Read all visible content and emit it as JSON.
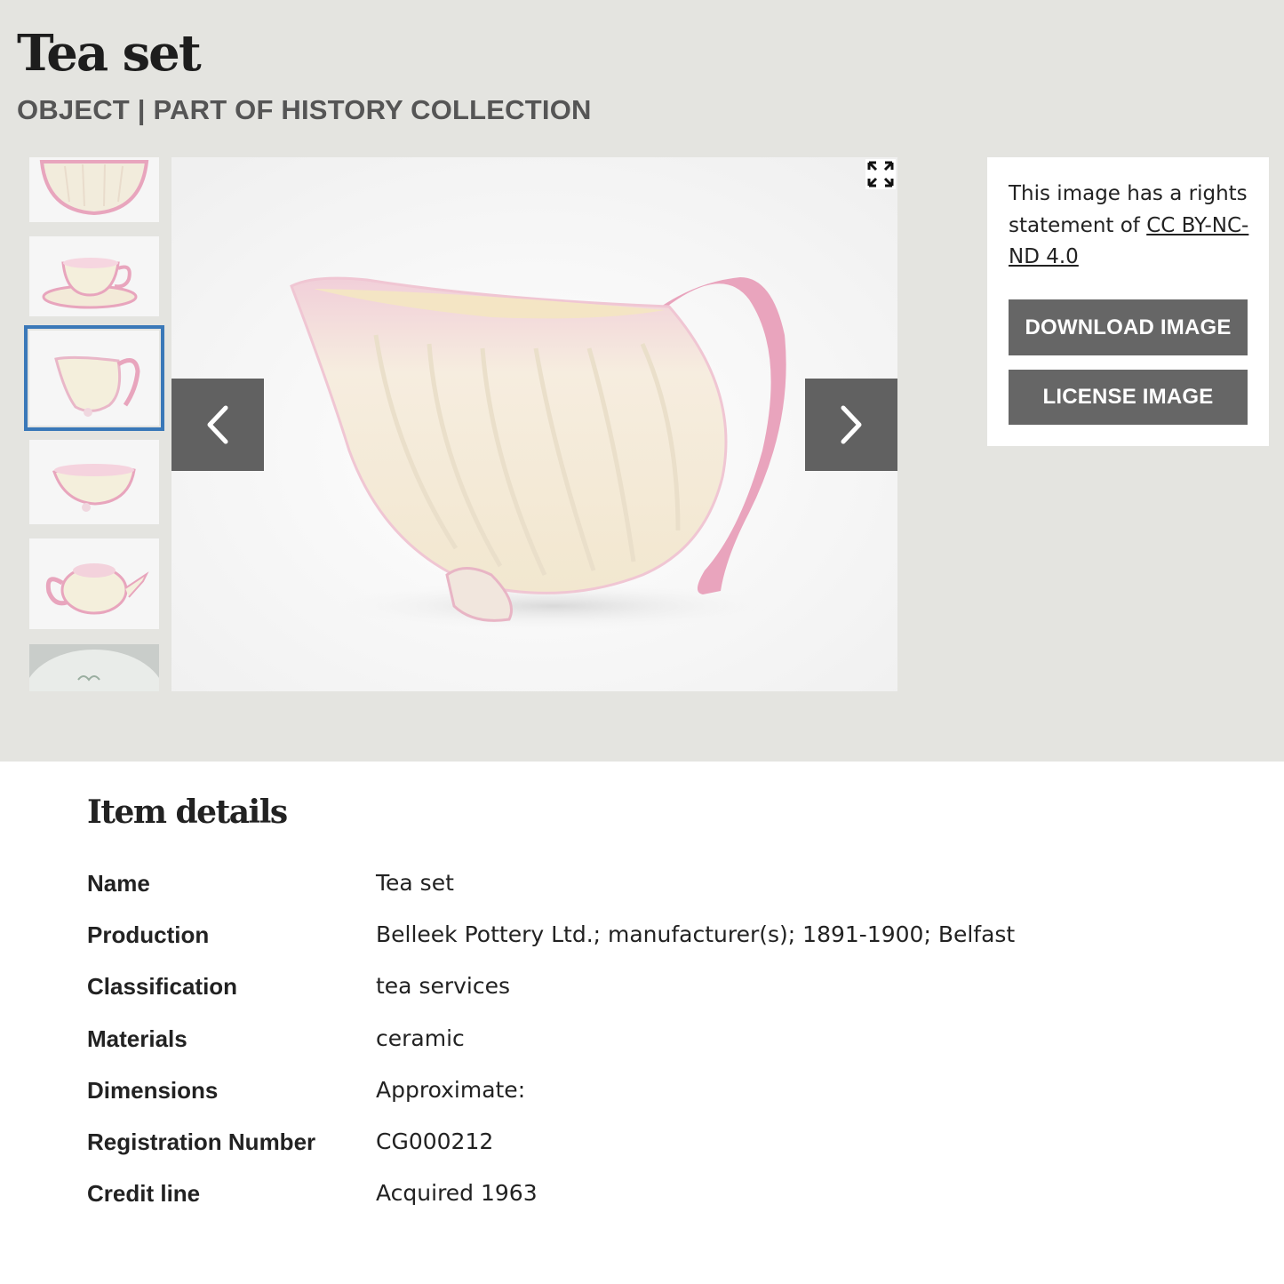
{
  "header": {
    "title": "Tea set",
    "subtitle": "OBJECT | PART OF HISTORY COLLECTION"
  },
  "gallery": {
    "thumbnails": [
      {
        "name": "dish"
      },
      {
        "name": "cup and saucer"
      },
      {
        "name": "cream jug",
        "selected": true
      },
      {
        "name": "sugar bowl"
      },
      {
        "name": "teapot"
      },
      {
        "name": "plate"
      }
    ],
    "prev_icon": "chevron-left-icon",
    "next_icon": "chevron-right-icon",
    "fullscreen_icon": "expand-icon"
  },
  "rights": {
    "text": "This image has a rights statement of ",
    "license_link": "CC BY-NC-ND 4.0",
    "download_label": "DOWNLOAD IMAGE",
    "license_label": "LICENSE IMAGE"
  },
  "details": {
    "title": "Item details",
    "rows": [
      {
        "label": "Name",
        "value": "Tea set"
      },
      {
        "label": "Production",
        "value": "Belleek Pottery Ltd.; manufacturer(s); 1891-1900; Belfast"
      },
      {
        "label": "Classification",
        "value": "tea services"
      },
      {
        "label": "Materials",
        "value": "ceramic"
      },
      {
        "label": "Dimensions",
        "value": "Approximate:"
      },
      {
        "label": "Registration Number",
        "value": "CG000212"
      },
      {
        "label": "Credit line",
        "value": "Acquired 1963"
      }
    ]
  },
  "colors": {
    "band": "#e4e4e0",
    "button": "#666666",
    "nav": "#616161",
    "selected_outline": "#3a78b8",
    "pink": "#e8a5bd",
    "cream": "#f4efdc"
  }
}
